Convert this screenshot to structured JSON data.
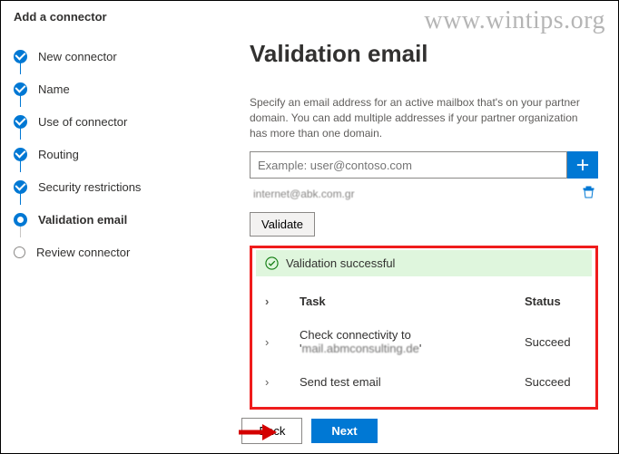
{
  "watermark": "www.wintips.org",
  "header": {
    "title": "Add a connector"
  },
  "sidebar": {
    "items": [
      {
        "label": "New connector",
        "state": "done"
      },
      {
        "label": "Name",
        "state": "done"
      },
      {
        "label": "Use of connector",
        "state": "done"
      },
      {
        "label": "Routing",
        "state": "done"
      },
      {
        "label": "Security restrictions",
        "state": "done"
      },
      {
        "label": "Validation email",
        "state": "current"
      },
      {
        "label": "Review connector",
        "state": "pending"
      }
    ]
  },
  "main": {
    "title": "Validation email",
    "description": "Specify an email address for an active mailbox that's on your partner domain. You can add multiple addresses if your partner organization has more than one domain.",
    "email_placeholder": "Example: user@contoso.com",
    "added_email": "internet@abk.com.gr",
    "validate_label": "Validate",
    "success_message": "Validation successful",
    "table": {
      "col_task": "Task",
      "col_status": "Status",
      "rows": [
        {
          "task_pre": "Check connectivity to '",
          "task_host": "mail.abmconsulting.de",
          "task_post": "'",
          "status": "Succeed"
        },
        {
          "task_pre": "Send test email",
          "task_host": "",
          "task_post": "",
          "status": "Succeed"
        }
      ]
    }
  },
  "footer": {
    "back_label": "Back",
    "next_label": "Next"
  }
}
